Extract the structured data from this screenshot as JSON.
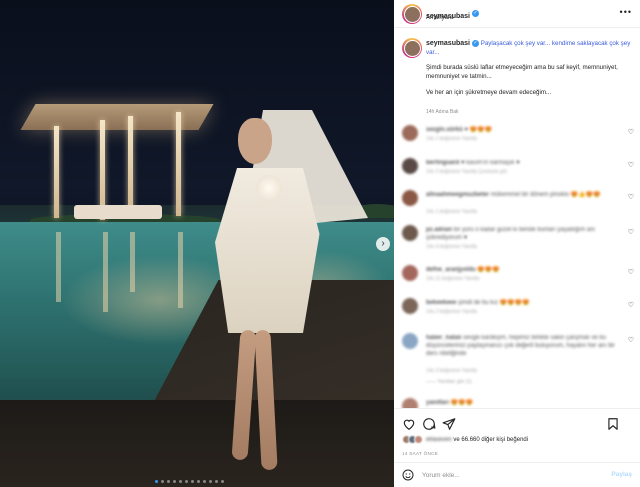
{
  "post": {
    "username": "seymasubasi",
    "location": "Amanyara",
    "caption_lines": [
      "Paylaşacak çok şey var... kendime saklayacak çok şey var...",
      "",
      "Şimdi burada süslü laflar etmeyeceğim ama bu saf keyif, memnuniyet, memnuniyet ve tatmin...",
      "",
      "Ve her an için şükretmeye devam edeceğim..."
    ],
    "caption_time": "14h  Adına Bak",
    "likes_text": "ve 66.660 diğer kişi beğendi",
    "likes_blurred_name": "elfaseven",
    "time_ago": "14 SAAT ÖNCE",
    "carousel_total": 12,
    "carousel_active": 0
  },
  "comments": [
    {
      "user": "sezgin.sürkü",
      "text": "♥ 😍😍😍",
      "meta": "14s   1 beğenme   Yanıtla",
      "avatar_color": "#9b6a5a"
    },
    {
      "user": "berfinguard",
      "text": "♥ kasım'ın karmaşık ♥",
      "meta": "14s   2 beğenme   Yanıtla   Çevirisini gör",
      "avatar_color": "#5a4a46"
    },
    {
      "user": "alinaahmeegmuzbeter",
      "text": "mükemmel bir dönem pinokio 😍👍😍😍",
      "meta": "14s   1 beğenme   Yanıtla",
      "avatar_color": "#8a5844"
    },
    {
      "user": "pz.adnan",
      "text": "bir yürü o kadar güzel ki bende bunları yaşadığım anı şükrediyorum ♥",
      "meta": "14s   4 beğenme   Yanıtla",
      "avatar_color": "#6d5a4c"
    },
    {
      "user": "defne_aranjyoldu",
      "text": "😍😍😍",
      "meta": "14s   11 beğenme   Yanıtla",
      "avatar_color": "#a4675d"
    },
    {
      "user": "bekeekeee",
      "text": "şimdi de bu kız 😍😍😍😍",
      "meta": "14s   2 beğenme   Yanıtla",
      "avatar_color": "#7b6659"
    },
    {
      "user": "haber_hatalı",
      "text": "sevgili kardeşim, hepimiz birlikte sakin çalışmalı ve bu düşüncelerinizi paylaşmanızı çok değerli buluyorum, hayatın her anı bir ders niteliğinde",
      "meta": "14s   3 beğenme   Yanıtla",
      "avatar_color": "#8aa6c4",
      "replies": "Yanıtları gör (1)"
    },
    {
      "user": "yanıtları",
      "text": "😍😍😍",
      "meta": "",
      "avatar_color": "#b08070"
    }
  ],
  "ui": {
    "more_glyph": "•••",
    "heart_glyph": "♡",
    "verified_glyph": "✓",
    "next_glyph": "›",
    "comment_placeholder": "Yorum ekle...",
    "share_label": "Paylaş"
  }
}
